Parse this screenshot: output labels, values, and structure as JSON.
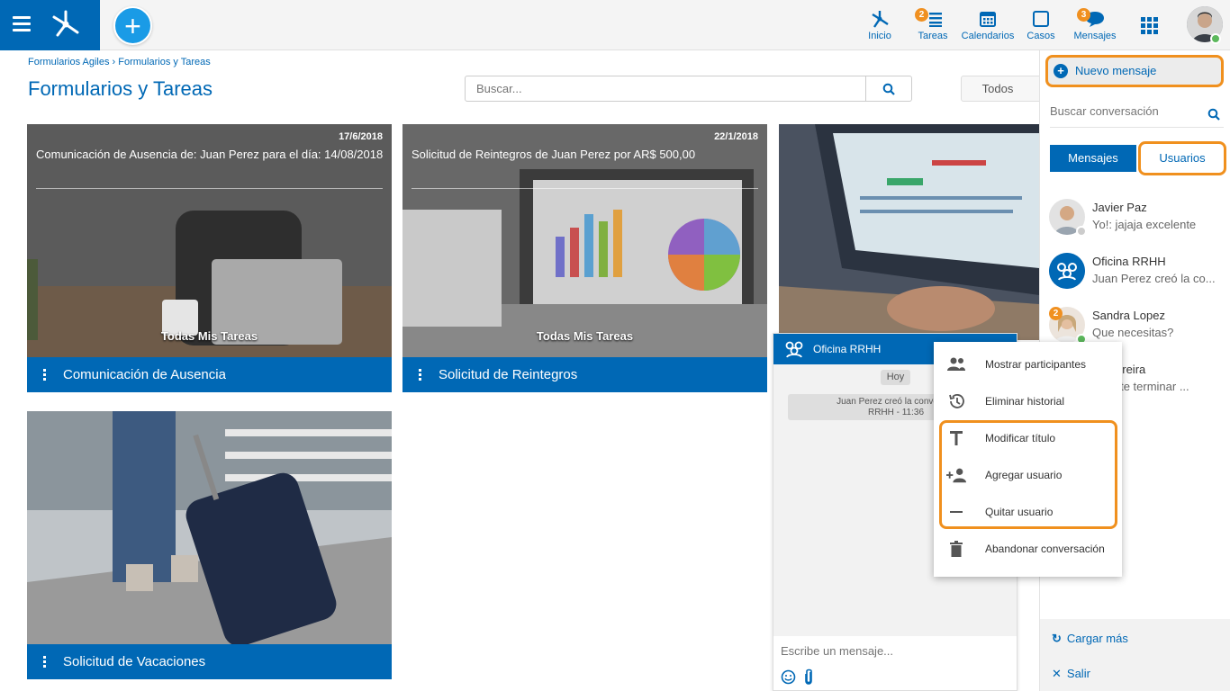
{
  "header": {
    "nav": [
      {
        "label": "Inicio",
        "icon": "home-network-icon",
        "badge": ""
      },
      {
        "label": "Tareas",
        "icon": "tasks-icon",
        "badge": "2"
      },
      {
        "label": "Calendarios",
        "icon": "calendar-icon",
        "badge": ""
      },
      {
        "label": "Casos",
        "icon": "cases-icon",
        "badge": ""
      },
      {
        "label": "Mensajes",
        "icon": "messages-icon",
        "badge": "3"
      }
    ],
    "accent": "#0068b5",
    "badge_color": "#f09020"
  },
  "breadcrumb": "Formularios Agiles › Formularios y Tareas",
  "page_title": "Formularios y Tareas",
  "search": {
    "placeholder": "Buscar..."
  },
  "filter": {
    "selected": "Todos"
  },
  "cards": [
    {
      "date": "17/6/2018",
      "title": "Comunicación de Ausencia de: Juan Perez para el día: 14/08/2018",
      "overlay": "Todas Mis Tareas",
      "name": "Comunicación de Ausencia"
    },
    {
      "date": "22/1/2018",
      "title": "Solicitud de Reintegros de Juan Perez por AR$ 500,00",
      "overlay": "Todas Mis Tareas",
      "name": "Solicitud de Reintegros"
    },
    {
      "date": "",
      "title": "",
      "overlay": "",
      "name": ""
    },
    {
      "date": "",
      "title": "",
      "overlay": "",
      "name": "Solicitud de Vacaciones"
    }
  ],
  "messages_panel": {
    "new_message": "Nuevo mensaje",
    "search_placeholder": "Buscar conversación",
    "tab_messages": "Mensajes",
    "tab_users": "Usuarios",
    "conversations": [
      {
        "name": "Javier Paz",
        "text": "Yo!: jajaja excelente"
      },
      {
        "name": "Oficina RRHH",
        "text": "Juan Perez creó la co..."
      },
      {
        "name": "Sandra Lopez",
        "text": "Que necesitas?",
        "badge": "2"
      },
      {
        "name": "tin Pereira",
        "text": "pudiste terminar ..."
      }
    ],
    "load_more": "Cargar más",
    "exit": "Salir"
  },
  "chat": {
    "title": "Oficina RRHH",
    "day": "Hoy",
    "system_message_line1": "Juan Perez creó la conversac",
    "system_message_line2": "RRHH - 11:36",
    "input_placeholder": "Escribe un mensaje..."
  },
  "context_menu": [
    {
      "label": "Mostrar participantes",
      "icon": "participants-icon"
    },
    {
      "label": "Eliminar historial",
      "icon": "history-icon"
    },
    {
      "label": "Modificar título",
      "icon": "text-title-icon"
    },
    {
      "label": "Agregar usuario",
      "icon": "add-user-icon"
    },
    {
      "label": "Quitar usuario",
      "icon": "remove-icon"
    },
    {
      "label": "Abandonar conversación",
      "icon": "trash-icon"
    }
  ],
  "highlight_color": "#f0901e"
}
